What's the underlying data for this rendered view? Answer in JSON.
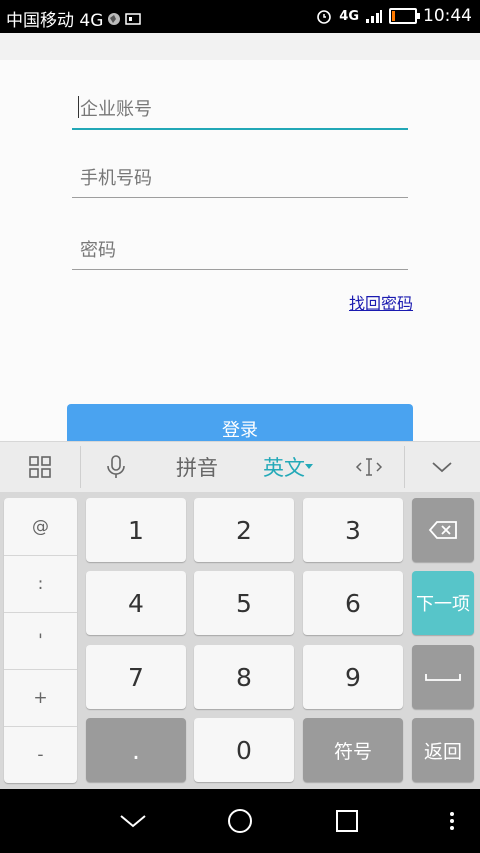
{
  "status_bar": {
    "carrier": "中国移动 4G",
    "network": "4G",
    "time": "10:44",
    "battery_level": 0.15,
    "battery_color": "#ff7a00"
  },
  "form": {
    "company_account_placeholder": "企业账号",
    "phone_placeholder": "手机号码",
    "password_placeholder": "密码",
    "forgot_password": "找回密码",
    "login_button": "登录"
  },
  "keyboard": {
    "toolbar": {
      "pinyin": "拼音",
      "english": "英文"
    },
    "symbols": [
      "@",
      ":",
      "'",
      "+",
      "-"
    ],
    "digits": [
      "1",
      "2",
      "3",
      "4",
      "5",
      "6",
      "7",
      "8",
      "9",
      "0"
    ],
    "dot": ".",
    "next_label": "下一项",
    "symbols_label": "符号",
    "return_label": "返回"
  },
  "colors": {
    "accent": "#21a7b6",
    "button_blue": "#4aa3f0",
    "link": "#1a1ab0"
  }
}
